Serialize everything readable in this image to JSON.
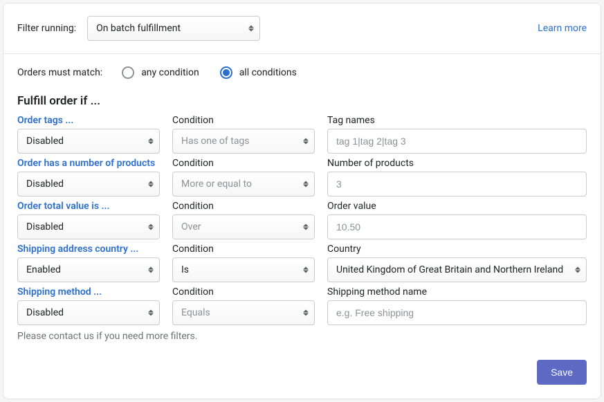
{
  "header": {
    "filter_running_label": "Filter running:",
    "filter_running_value": "On batch fulfillment",
    "learn_more": "Learn more"
  },
  "match": {
    "label": "Orders must match:",
    "any": "any condition",
    "all": "all conditions"
  },
  "section_title": "Fulfill order if ...",
  "labels": {
    "condition": "Condition"
  },
  "filters": [
    {
      "title": "Order tags ...",
      "enabled_value": "Disabled",
      "condition_value": "Has one of tags",
      "value_label": "Tag names",
      "value_placeholder": "tag 1|tag 2|tag 3",
      "value_type": "input"
    },
    {
      "title": "Order has a number of products",
      "enabled_value": "Disabled",
      "condition_value": "More or equal to",
      "value_label": "Number of products",
      "value_placeholder": "3",
      "value_type": "input"
    },
    {
      "title": "Order total value is ...",
      "enabled_value": "Disabled",
      "condition_value": "Over",
      "value_label": "Order value",
      "value_placeholder": "10.50",
      "value_type": "input"
    },
    {
      "title": "Shipping address country ...",
      "enabled_value": "Enabled",
      "condition_value": "Is",
      "value_label": "Country",
      "value_text": "United Kingdom of Great Britain and Northern Ireland",
      "value_type": "select"
    },
    {
      "title": "Shipping method ...",
      "enabled_value": "Disabled",
      "condition_value": "Equals",
      "value_label": "Shipping method name",
      "value_placeholder": "e.g. Free shipping",
      "value_type": "input"
    }
  ],
  "help_text": "Please contact us if you need more filters.",
  "save_button": "Save"
}
